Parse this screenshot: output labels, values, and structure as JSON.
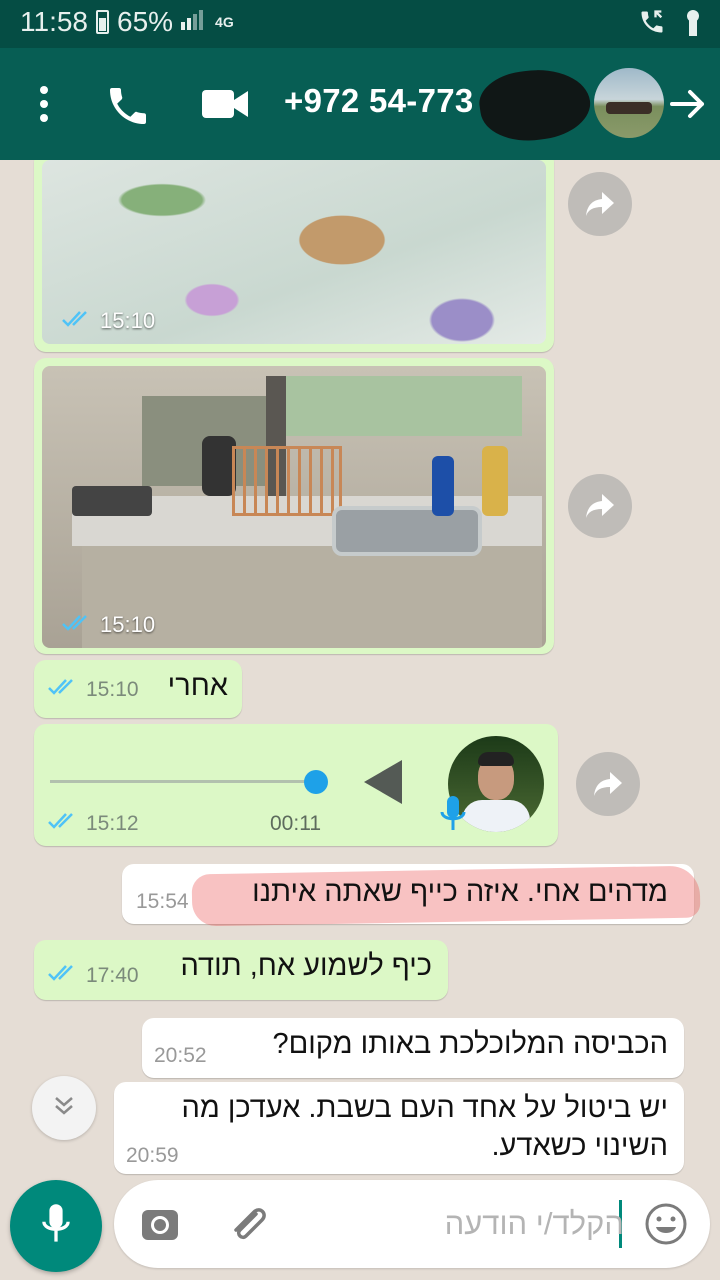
{
  "status_bar": {
    "time": "11:58",
    "battery": "65%",
    "network": "4G",
    "icons": [
      "battery-icon",
      "signal-icon",
      "wifi-call-icon",
      "lock-icon"
    ]
  },
  "header": {
    "title": "+972 54-773",
    "icons": [
      "more-options-icon",
      "phone-call-icon",
      "video-call-icon",
      "contact-avatar",
      "back-arrow-icon"
    ]
  },
  "messages": [
    {
      "type": "image",
      "direction": "outgoing",
      "description_icon": "bed-photo",
      "time": "15:10",
      "status": "read"
    },
    {
      "type": "image",
      "direction": "outgoing",
      "description_icon": "kitchen-photo",
      "time": "15:10",
      "status": "read"
    },
    {
      "type": "text",
      "direction": "outgoing",
      "text": "אחרי",
      "time": "15:10",
      "status": "read"
    },
    {
      "type": "voice",
      "direction": "outgoing",
      "duration": "00:11",
      "time": "15:12",
      "status": "read",
      "progress": 1.0
    },
    {
      "type": "text",
      "direction": "incoming",
      "text": "מדהים אחי. איזה כייף שאתה איתנו",
      "time": "15:54"
    },
    {
      "type": "text",
      "direction": "outgoing",
      "text": "כיף לשמוע אח, תודה",
      "time": "17:40",
      "status": "read"
    },
    {
      "type": "text",
      "direction": "incoming",
      "text": "הכביסה המלוכלכת באותו מקום?",
      "time": "20:52"
    },
    {
      "type": "text",
      "direction": "incoming",
      "lines": [
        "יש ביטול על אחד העם בשבת. אעדכן מה",
        "השינוי כשאדע."
      ],
      "time": "20:59"
    }
  ],
  "input": {
    "placeholder": "הקלד/י הודעה",
    "icons": [
      "microphone-icon",
      "camera-icon",
      "attach-icon",
      "emoji-icon"
    ]
  },
  "colors": {
    "header": "#075e54",
    "status_bar": "#054d44",
    "outgoing_bubble": "#dcf8c6",
    "incoming_bubble": "#ffffff",
    "chat_background": "#e5ddd5",
    "read_ticks": "#4fc3f7",
    "fab": "#00897b"
  }
}
